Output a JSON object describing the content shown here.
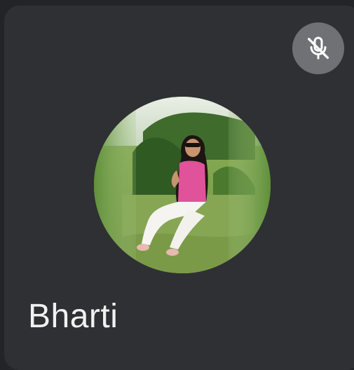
{
  "participant": {
    "name": "Bharti",
    "mic_status_icon": "mic-off-icon",
    "avatar_icon": "profile-photo"
  },
  "colors": {
    "tile_background": "#2f3034",
    "mute_button_background": "#707175",
    "name_text": "#f1f1f1"
  }
}
